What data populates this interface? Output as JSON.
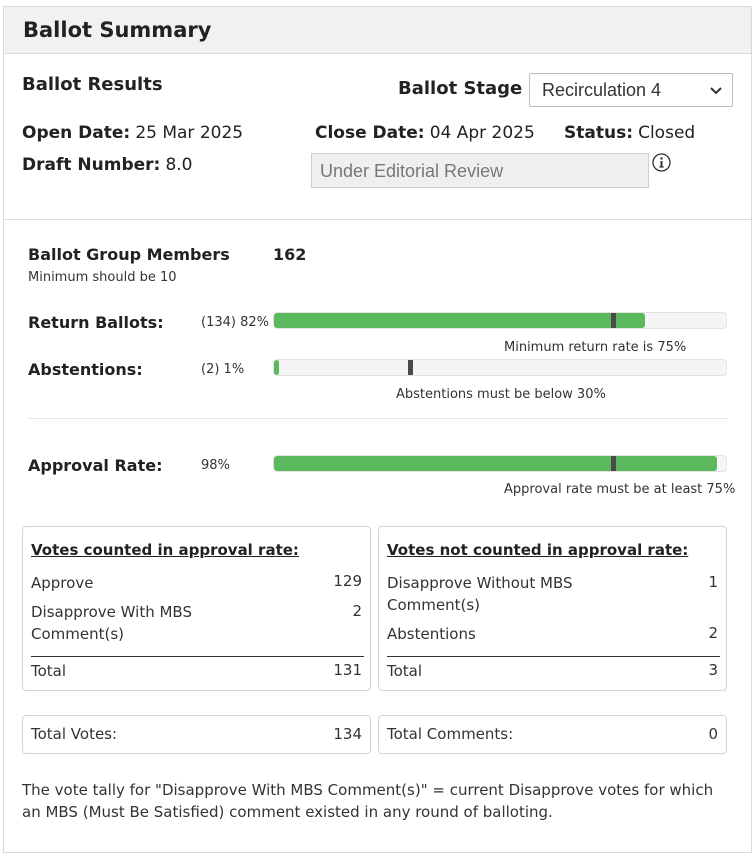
{
  "header": {
    "title": "Ballot Summary"
  },
  "results": {
    "heading": "Ballot Results",
    "stage_label": "Ballot Stage",
    "stage_value": "Recirculation 4",
    "open_label": "Open Date:",
    "open_value": "25 Mar 2025",
    "close_label": "Close Date:",
    "close_value": "04 Apr 2025",
    "status_label": "Status:",
    "status_value": "Closed",
    "draft_label": "Draft Number:",
    "draft_value": "8.0",
    "review_status": "Under Editorial Review"
  },
  "group": {
    "label": "Ballot Group Members",
    "value": "162",
    "note": "Minimum should be 10"
  },
  "return_ballots": {
    "label": "Return Ballots:",
    "count_text": "(134) 82%",
    "percent": 82,
    "threshold": 75,
    "note": "Minimum return rate is 75%"
  },
  "abstentions": {
    "label": "Abstentions:",
    "count_text": "(2) 1%",
    "percent": 1,
    "threshold": 30,
    "note": "Abstentions must be below 30%"
  },
  "approval": {
    "label": "Approval Rate:",
    "count_text": "98%",
    "percent": 98,
    "threshold": 75,
    "note": "Approval rate must be at least 75%"
  },
  "counted": {
    "heading": "Votes counted in approval rate:",
    "rows": [
      {
        "label": "Approve",
        "value": "129"
      },
      {
        "label": "Disapprove With MBS Comment(s)",
        "value": "2"
      }
    ],
    "total_label": "Total",
    "total_value": "131"
  },
  "not_counted": {
    "heading": "Votes not counted in approval rate:",
    "rows": [
      {
        "label": "Disapprove Without MBS Comment(s)",
        "value": "1"
      },
      {
        "label": "Abstentions",
        "value": "2"
      }
    ],
    "total_label": "Total",
    "total_value": "3"
  },
  "totals": {
    "votes_label": "Total Votes:",
    "votes_value": "134",
    "comments_label": "Total Comments:",
    "comments_value": "0"
  },
  "footnote": "The vote tally for \"Disapprove With MBS Comment(s)\" = current Disapprove votes for which an MBS (Must Be Satisfied) comment existed in any round of balloting.",
  "colors": {
    "bar_fill": "#5cb85c",
    "marker": "#4a4a4a"
  },
  "icons": {
    "info": "info-icon",
    "dropdown": "chevron-down-icon"
  }
}
